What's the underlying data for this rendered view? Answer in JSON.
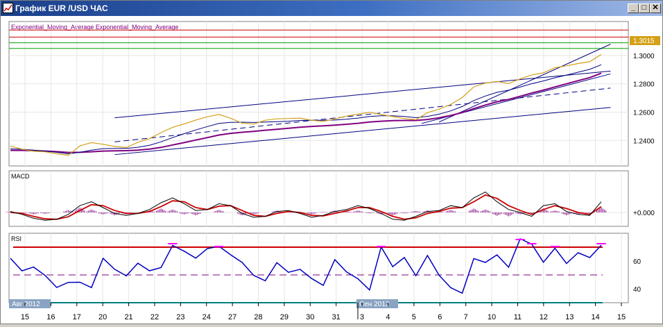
{
  "window": {
    "title": "График EUR /USD  ЧАС",
    "buttons": [
      "_",
      "□",
      "✕"
    ]
  },
  "colors": {
    "price": "#d4a017",
    "ema_fast": "#000080",
    "ema_slow": "#800080",
    "channel": "#000080",
    "hline_red": "#cc0000",
    "hline_green": "#00a000",
    "macd_line": "#000000",
    "macd_signal": "#cc0000",
    "macd_hist": "#800080",
    "rsi_line": "#0000c0",
    "rsi_over": "#ff00ff",
    "rsi_levels": "#cc0000"
  },
  "chart_data": [
    {
      "type": "line",
      "panel": "price",
      "title": "Exponential_Moving_Average Exponential_Moving_Average",
      "last_price_label": "1.3015",
      "y_ticks": [
        "1.3000",
        "1.2800",
        "1.2600",
        "1.2400"
      ],
      "ylim": [
        1.222,
        1.324
      ],
      "x_days": [
        "15",
        "16",
        "17",
        "20",
        "21",
        "22",
        "23",
        "24",
        "27",
        "28",
        "29",
        "30",
        "31",
        "3",
        "4",
        "5",
        "6",
        "7",
        "10",
        "11",
        "12",
        "13",
        "14",
        "15"
      ],
      "month_labels": [
        "Авг 2012",
        "Сен 2012"
      ],
      "series": [
        {
          "values": [
            1.236,
            1.2345,
            1.233,
            1.232,
            1.23,
            1.2288,
            1.236,
            1.239,
            1.238,
            1.236,
            1.2345,
            1.238,
            1.241,
            1.246,
            1.25,
            1.252,
            1.254,
            1.256,
            1.258,
            1.256,
            1.253,
            1.252,
            1.254,
            1.2545,
            1.255,
            1.256,
            1.255,
            1.254,
            1.255,
            1.2565,
            1.258,
            1.26,
            1.259,
            1.2575,
            1.2555,
            1.254,
            1.259,
            1.262,
            1.266,
            1.271,
            1.278,
            1.28,
            1.281,
            1.28,
            1.284,
            1.287,
            1.288,
            1.291,
            1.292,
            1.294,
            1.296,
            1.3015
          ]
        },
        {
          "values": [
            1.234,
            1.2338,
            1.2332,
            1.2325,
            1.2316,
            1.2306,
            1.2316,
            1.2332,
            1.2342,
            1.2344,
            1.2344,
            1.2352,
            1.2366,
            1.239,
            1.242,
            1.2448,
            1.2474,
            1.2498,
            1.252,
            1.2528,
            1.2529,
            1.2527,
            1.253,
            1.2533,
            1.2536,
            1.2541,
            1.2543,
            1.2542,
            1.2544,
            1.255,
            1.2558,
            1.2569,
            1.2574,
            1.2574,
            1.2569,
            1.2561,
            1.257,
            1.2586,
            1.2609,
            1.264,
            1.2682,
            1.2714,
            1.274,
            1.2755,
            1.2777,
            1.2801,
            1.282,
            1.2843,
            1.2862,
            1.2882,
            1.2902,
            1.2935
          ]
        },
        {
          "values": [
            1.233,
            1.233,
            1.2328,
            1.2325,
            1.2321,
            1.2315,
            1.2316,
            1.232,
            1.2325,
            1.2327,
            1.2328,
            1.2332,
            1.2339,
            1.2351,
            1.2368,
            1.2385,
            1.2403,
            1.242,
            1.2438,
            1.245,
            1.2458,
            1.2464,
            1.2472,
            1.2479,
            1.2486,
            1.2493,
            1.2499,
            1.2503,
            1.2508,
            1.2514,
            1.2521,
            1.253,
            1.2536,
            1.254,
            1.2541,
            1.2541,
            1.2548,
            1.256,
            1.2576,
            1.2597,
            1.2625,
            1.265,
            1.2673,
            1.269,
            1.2712,
            1.2735,
            1.2755,
            1.2778,
            1.28,
            1.2822,
            1.2844,
            1.2875
          ]
        }
      ]
    },
    {
      "type": "bar",
      "panel": "macd",
      "title": "MACD",
      "y_ticks": [
        "+0.000"
      ],
      "ylim": [
        -1,
        1
      ],
      "series": [
        {
          "values": [
            0.05,
            -0.1,
            -0.3,
            -0.4,
            -0.35,
            -0.1,
            0.35,
            0.55,
            0.25,
            -0.05,
            -0.15,
            -0.05,
            0.15,
            0.5,
            0.75,
            0.45,
            0.1,
            0.15,
            0.45,
            0.35,
            -0.05,
            -0.25,
            -0.2,
            0.05,
            0.1,
            -0.05,
            -0.25,
            -0.15,
            0.05,
            0.15,
            0.35,
            0.2,
            -0.05,
            -0.35,
            -0.4,
            -0.2,
            0.05,
            0.1,
            0.35,
            0.25,
            0.75,
            1.05,
            0.55,
            0.15,
            0.0,
            -0.2,
            0.35,
            0.45,
            0.05,
            -0.1,
            -0.15,
            0.55
          ]
        },
        {
          "values": [
            0.0,
            -0.05,
            -0.2,
            -0.33,
            -0.35,
            -0.22,
            0.1,
            0.4,
            0.35,
            0.1,
            -0.05,
            -0.05,
            0.05,
            0.3,
            0.6,
            0.55,
            0.25,
            0.15,
            0.32,
            0.35,
            0.1,
            -0.15,
            -0.2,
            -0.05,
            0.05,
            0.0,
            -0.15,
            -0.18,
            -0.05,
            0.08,
            0.25,
            0.25,
            0.05,
            -0.2,
            -0.35,
            -0.28,
            -0.05,
            0.05,
            0.22,
            0.25,
            0.55,
            0.9,
            0.72,
            0.35,
            0.1,
            -0.1,
            0.15,
            0.35,
            0.2,
            0.0,
            -0.1,
            0.3
          ]
        },
        {
          "values": [
            0.05,
            -0.05,
            -0.1,
            -0.07,
            0.0,
            0.12,
            0.25,
            0.15,
            -0.1,
            -0.15,
            -0.1,
            0.0,
            0.1,
            0.2,
            0.15,
            -0.1,
            -0.15,
            0.0,
            0.13,
            0.0,
            -0.15,
            -0.1,
            0.0,
            0.1,
            0.05,
            -0.05,
            -0.1,
            0.03,
            0.1,
            0.07,
            0.1,
            -0.05,
            -0.1,
            -0.15,
            -0.05,
            0.08,
            0.1,
            0.05,
            0.13,
            0.0,
            0.2,
            0.15,
            -0.17,
            -0.2,
            -0.1,
            -0.1,
            0.2,
            0.1,
            -0.15,
            -0.1,
            -0.05,
            0.25
          ]
        }
      ]
    },
    {
      "type": "line",
      "panel": "rsi",
      "title": "RSI",
      "y_ticks": [
        "60",
        "40"
      ],
      "ylim": [
        30,
        80
      ],
      "levels": [
        70,
        50,
        30
      ],
      "series": [
        {
          "values": [
            62,
            52,
            55,
            50,
            42,
            45,
            44,
            40,
            62,
            55,
            50,
            58,
            52,
            55,
            72,
            68,
            62,
            68,
            70,
            65,
            60,
            50,
            45,
            58,
            52,
            55,
            48,
            42,
            60,
            52,
            48,
            40,
            70,
            55,
            62,
            50,
            65,
            50,
            40,
            36,
            62,
            60,
            65,
            55,
            75,
            72,
            60,
            70,
            58,
            65,
            62,
            72
          ]
        }
      ]
    }
  ]
}
